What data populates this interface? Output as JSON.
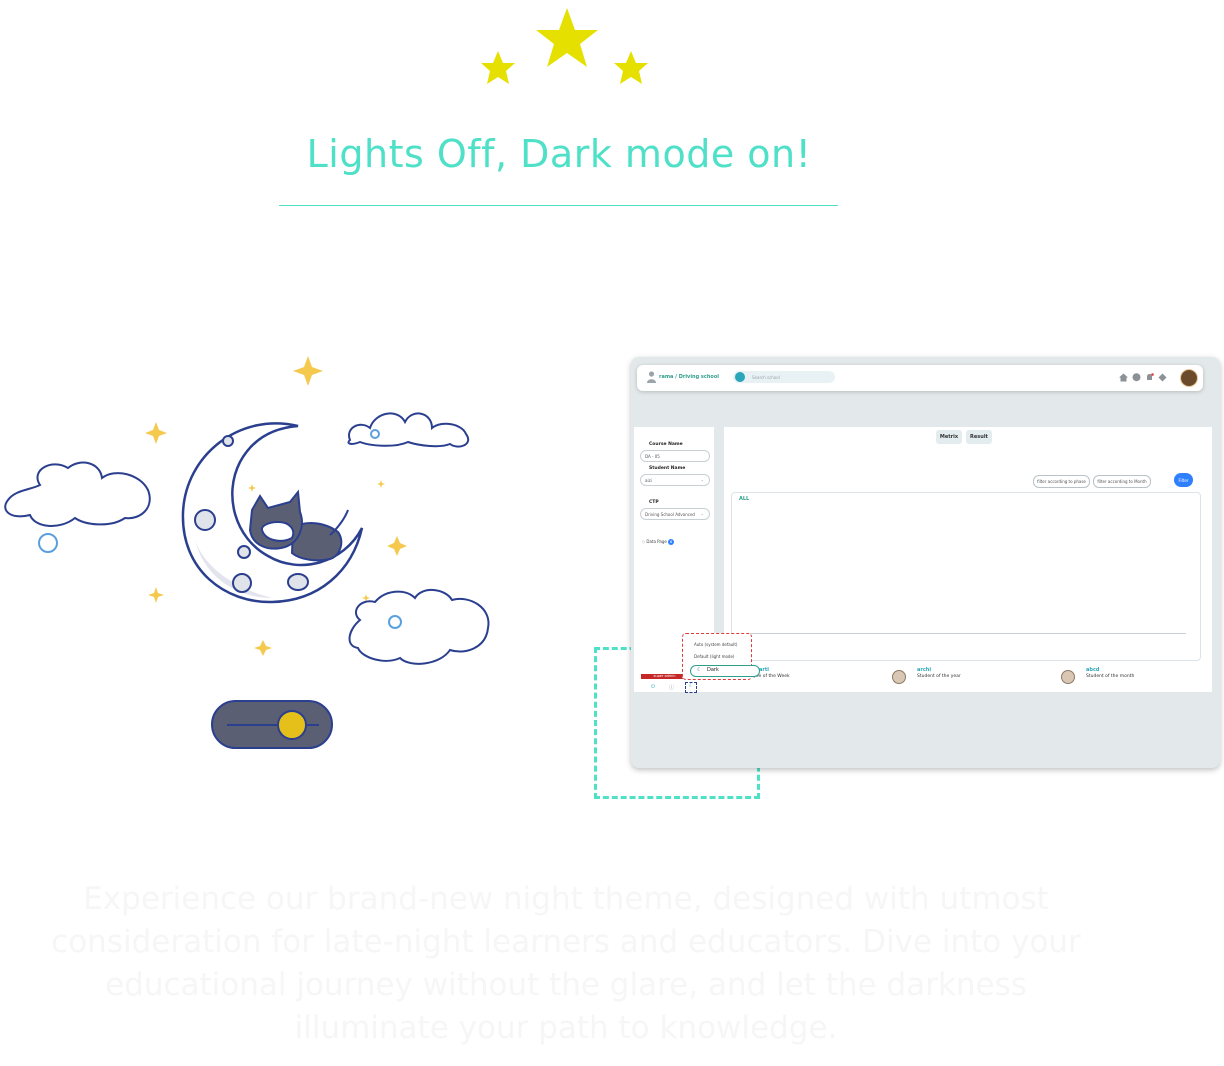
{
  "hero": {
    "title": "Lights Off, Dark mode on!",
    "description": "Experience our brand-new night theme, designed with utmost consideration for late-night learners and educators. Dive into your educational journey without the glare, and let the darkness illuminate your path to knowledge."
  },
  "colors": {
    "accent": "#4fe0c8",
    "star": "#e6e000",
    "toggle_track": "#5a5f73",
    "toggle_knob": "#e6c01a",
    "moon_outline": "#2b3f8f"
  },
  "app": {
    "breadcrumb": "rama / Driving school",
    "search_placeholder": "Search school",
    "header_icons": [
      "home-icon",
      "chat-icon",
      "bell-icon",
      "diamond-icon"
    ],
    "sidebar": {
      "course_label": "Course Name",
      "course_value": "DA - 05",
      "student_label": "Student Name",
      "student_value": "aizi",
      "ctp_label": "CTP",
      "ctp_value": "Driving School Advanced",
      "data_page_label": "Data Page",
      "data_page_badge": "6",
      "super_admin": "super admin"
    },
    "tabs": [
      "Metrix",
      "Result"
    ],
    "filters": {
      "phase": "filter according to phase",
      "month": "filter according to Month",
      "button": "Filter"
    },
    "chart_label": "ALL",
    "awards": [
      {
        "name": "arti",
        "title": "Employee of the Week"
      },
      {
        "name": "archi",
        "title": "Student of the year"
      },
      {
        "name": "abcd",
        "title": "Student of the month"
      }
    ],
    "theme_menu": {
      "auto": "Auto (system default)",
      "light": "Default (light mode)",
      "dark": "Dark"
    }
  }
}
